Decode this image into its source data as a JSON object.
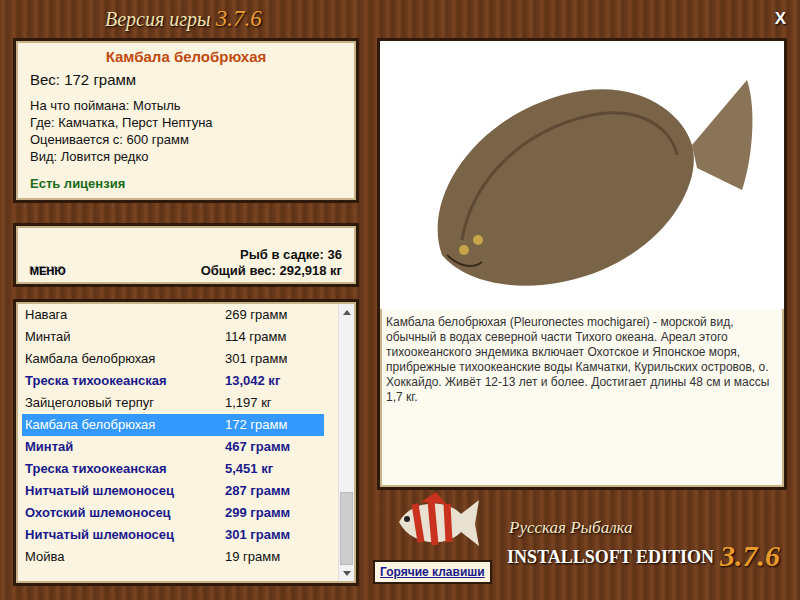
{
  "window": {
    "title": "Версия игры",
    "version": "3.7.6",
    "close": "X"
  },
  "fish_card": {
    "name": "Камбала белобрюхая",
    "weight": "Вес: 172 грамм",
    "details": [
      "На что поймана: Мотыль",
      "Где: Камчатка, Перст Нептуна",
      "Оценивается с: 600 грамм",
      "Вид: Ловится редко"
    ],
    "license": "Есть лицензия"
  },
  "summary": {
    "menu_button": "МЕНЮ",
    "count": "Рыб в садке: 36",
    "total": "Общий вес: 292,918 кг"
  },
  "catch_list": {
    "rows": [
      {
        "name": "Навага",
        "weight": "269 грамм",
        "highlighted": false,
        "selected": false
      },
      {
        "name": "Минтай",
        "weight": "114 грамм",
        "highlighted": false,
        "selected": false
      },
      {
        "name": "Камбала белобрюхая",
        "weight": "301 грамм",
        "highlighted": false,
        "selected": false
      },
      {
        "name": "Треска тихоокеанская",
        "weight": "13,042 кг",
        "highlighted": true,
        "selected": false
      },
      {
        "name": "Зайцеголовый терпуг",
        "weight": "1,197 кг",
        "highlighted": false,
        "selected": false
      },
      {
        "name": "Камбала белобрюхая",
        "weight": "172 грамм",
        "highlighted": false,
        "selected": true
      },
      {
        "name": "Минтай",
        "weight": "467 грамм",
        "highlighted": true,
        "selected": false
      },
      {
        "name": "Треска тихоокеанская",
        "weight": "5,451 кг",
        "highlighted": true,
        "selected": false
      },
      {
        "name": "Нитчатый шлемоносец",
        "weight": "287 грамм",
        "highlighted": true,
        "selected": false
      },
      {
        "name": "Охотский шлемоносец",
        "weight": "299 грамм",
        "highlighted": true,
        "selected": false
      },
      {
        "name": "Нитчатый шлемоносец",
        "weight": "301 грамм",
        "highlighted": true,
        "selected": false
      },
      {
        "name": "Мойва",
        "weight": "19 грамм",
        "highlighted": false,
        "selected": false
      }
    ],
    "scroll": {
      "position": 0.68,
      "level": 0.3
    }
  },
  "fish_info": {
    "description": "Камбала белобрюхая (Pleuronectes mochigarei) - морской вид, обычный в водах северной части Тихого океана. Ареал этого тихоокеанского эндемика включает Охотское и Японское моря, прибрежные тихоокеанские воды Камчатки, Курильских островов, о. Хоккайдо. Живёт 12-13 лет и более. Достигает длины 48 см и массы 1,7 кг."
  },
  "logo": {
    "line1": "Русская Рыбалка",
    "line2": "INSTALLSOFT EDITION",
    "version": "3.7.6"
  },
  "hotkeys_button": "Горячие клавиши"
}
